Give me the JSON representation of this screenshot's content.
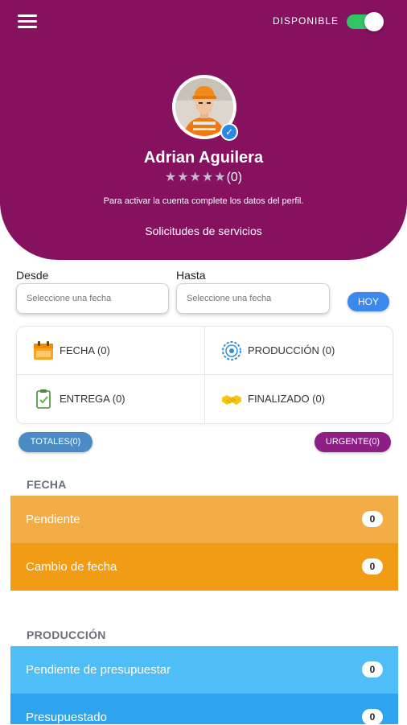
{
  "header": {
    "status_label": "DISPONIBLE",
    "status_on": true,
    "profile_name": "Adrian Aguilera",
    "stars": "★★★★★",
    "rating_count": "(0)",
    "notice": "Para activar la cuenta complete los datos del perfil.",
    "section_link": "Solicitudes de servicios"
  },
  "filters": {
    "desde_label": "Desde",
    "hasta_label": "Hasta",
    "desde_placeholder": "Seleccione una fecha",
    "hasta_placeholder": "Seleccione una fecha",
    "hoy_button": "HOY"
  },
  "categories": [
    {
      "label": "FECHA (0)",
      "icon": "calendar-icon"
    },
    {
      "label": "PRODUCCIÓN (0)",
      "icon": "gear-icon"
    },
    {
      "label": "ENTREGA (0)",
      "icon": "clipboard-check-icon"
    },
    {
      "label": "FINALIZADO (0)",
      "icon": "handshake-icon"
    }
  ],
  "pills": {
    "totales": "TOTALES(0)",
    "urgente": "URGENTE(0)"
  },
  "sections": [
    {
      "title": "FECHA",
      "rows": [
        {
          "label": "Pendiente",
          "count": "0",
          "color": "#f2ad46"
        },
        {
          "label": "Cambio de fecha",
          "count": "0",
          "color": "#f19c14"
        }
      ]
    },
    {
      "title": "PRODUCCIÓN",
      "rows": [
        {
          "label": "Pendiente de presupuestar",
          "count": "0",
          "color": "#4fbdf6"
        },
        {
          "label": "Presupuestado",
          "count": "0",
          "color": "#2ea3ee"
        }
      ]
    }
  ],
  "colors": {
    "header": "#85115f",
    "toggle_on": "#33c463",
    "hoy": "#3b88ef",
    "totales": "#4a8bc5",
    "urgente": "#8f1d86"
  }
}
